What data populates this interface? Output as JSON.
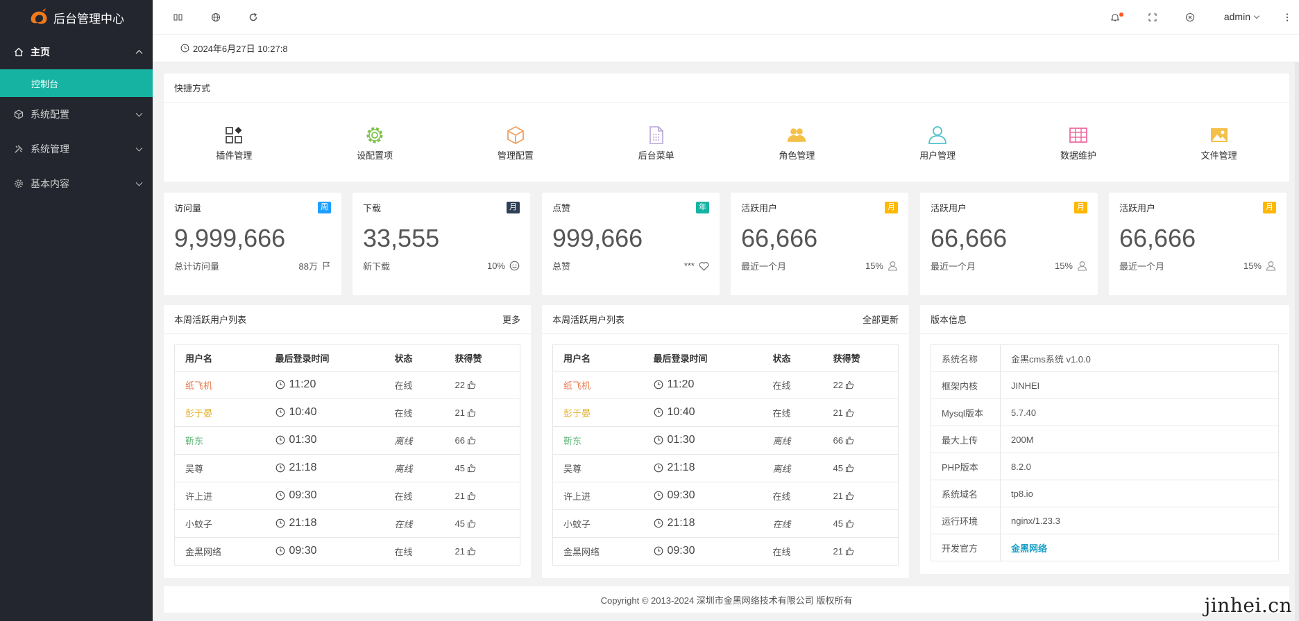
{
  "app": {
    "title": "后台管理中心"
  },
  "sidebar": {
    "items": [
      {
        "label": "主页",
        "icon": "home-icon"
      },
      {
        "label": "控制台"
      },
      {
        "label": "系统配置",
        "icon": "cube-icon"
      },
      {
        "label": "系统管理",
        "icon": "tools-icon"
      },
      {
        "label": "基本内容",
        "icon": "gear-icon"
      }
    ]
  },
  "header": {
    "user": "admin"
  },
  "timebar": {
    "datetime": "2024年6月27日 10:27:8"
  },
  "shortcuts": {
    "title": "快捷方式",
    "items": [
      {
        "label": "插件管理",
        "icon": "apps-icon",
        "color": "#333333"
      },
      {
        "label": "设配置项",
        "icon": "gear-icon",
        "color": "#7cc14a"
      },
      {
        "label": "管理配置",
        "icon": "box-icon",
        "color": "#f0a060"
      },
      {
        "label": "后台菜单",
        "icon": "document-icon",
        "color": "#b8a4d8"
      },
      {
        "label": "角色管理",
        "icon": "group-icon",
        "color": "#f5c04a"
      },
      {
        "label": "用户管理",
        "icon": "user-icon",
        "color": "#4ec2c9"
      },
      {
        "label": "数据维护",
        "icon": "table-icon",
        "color": "#f06ba0"
      },
      {
        "label": "文件管理",
        "icon": "image-icon",
        "color": "#f5c04a"
      }
    ]
  },
  "stats": [
    {
      "title": "访问量",
      "badge": "周",
      "badge_color": "#1e9fff",
      "value": "9,999,666",
      "foot_label": "总计访问量",
      "foot_value": "88万",
      "foot_icon": "flag-icon"
    },
    {
      "title": "下载",
      "badge": "月",
      "badge_color": "#2f4056",
      "value": "33,555",
      "foot_label": "新下载",
      "foot_value": "10%",
      "foot_icon": "smile-icon"
    },
    {
      "title": "点赞",
      "badge": "年",
      "badge_color": "#16b3a3",
      "value": "999,666",
      "foot_label": "总赞",
      "foot_value": "***",
      "foot_icon": "heart-icon"
    },
    {
      "title": "活跃用户",
      "badge": "月",
      "badge_color": "#ffb800",
      "value": "66,666",
      "foot_label": "最近一个月",
      "foot_value": "15%",
      "foot_icon": "user-icon"
    },
    {
      "title": "活跃用户",
      "badge": "月",
      "badge_color": "#ffb800",
      "value": "66,666",
      "foot_label": "最近一个月",
      "foot_value": "15%",
      "foot_icon": "user-icon"
    },
    {
      "title": "活跃用户",
      "badge": "月",
      "badge_color": "#ffb800",
      "value": "66,666",
      "foot_label": "最近一个月",
      "foot_value": "15%",
      "foot_icon": "user-icon"
    }
  ],
  "users_left": {
    "title": "本周活跃用户列表",
    "action": "更多",
    "columns": [
      "用户名",
      "最后登录时间",
      "状态",
      "获得赞"
    ],
    "rows": [
      {
        "name": "纸飞机",
        "color": "#e6784a",
        "time": "11:20",
        "status": "在线",
        "offline": false,
        "likes": "22"
      },
      {
        "name": "彭于晏",
        "color": "#e2b02a",
        "time": "10:40",
        "status": "在线",
        "offline": false,
        "likes": "21"
      },
      {
        "name": "靳东",
        "color": "#5fb878",
        "time": "01:30",
        "status": "离线",
        "offline": true,
        "likes": "66"
      },
      {
        "name": "吴尊",
        "color": "#555555",
        "time": "21:18",
        "status": "离线",
        "offline": true,
        "likes": "45"
      },
      {
        "name": "许上进",
        "color": "#555555",
        "time": "09:30",
        "status": "在线",
        "offline": false,
        "likes": "21"
      },
      {
        "name": "小蚊子",
        "color": "#555555",
        "time": "21:18",
        "status": "在线",
        "offline": true,
        "likes": "45"
      },
      {
        "name": "金黑网络",
        "color": "#555555",
        "time": "09:30",
        "status": "在线",
        "offline": false,
        "likes": "21"
      }
    ]
  },
  "users_right": {
    "title": "本周活跃用户列表",
    "action": "全部更新",
    "columns": [
      "用户名",
      "最后登录时间",
      "状态",
      "获得赞"
    ],
    "rows": [
      {
        "name": "纸飞机",
        "color": "#e6784a",
        "time": "11:20",
        "status": "在线",
        "offline": false,
        "likes": "22"
      },
      {
        "name": "彭于晏",
        "color": "#e2b02a",
        "time": "10:40",
        "status": "在线",
        "offline": false,
        "likes": "21"
      },
      {
        "name": "靳东",
        "color": "#5fb878",
        "time": "01:30",
        "status": "离线",
        "offline": true,
        "likes": "66"
      },
      {
        "name": "吴尊",
        "color": "#555555",
        "time": "21:18",
        "status": "离线",
        "offline": true,
        "likes": "45"
      },
      {
        "name": "许上进",
        "color": "#555555",
        "time": "09:30",
        "status": "在线",
        "offline": false,
        "likes": "21"
      },
      {
        "name": "小蚊子",
        "color": "#555555",
        "time": "21:18",
        "status": "在线",
        "offline": true,
        "likes": "45"
      },
      {
        "name": "金黑网络",
        "color": "#555555",
        "time": "09:30",
        "status": "在线",
        "offline": false,
        "likes": "21"
      }
    ]
  },
  "version": {
    "title": "版本信息",
    "rows": [
      {
        "key": "系统名称",
        "value": "金黑cms系统 v1.0.0"
      },
      {
        "key": "框架内核",
        "value": "JINHEI"
      },
      {
        "key": "Mysql版本",
        "value": "5.7.40"
      },
      {
        "key": "最大上传",
        "value": "200M"
      },
      {
        "key": "PHP版本",
        "value": "8.2.0"
      },
      {
        "key": "系统域名",
        "value": "tp8.io"
      },
      {
        "key": "运行环境",
        "value": "nginx/1.23.3"
      },
      {
        "key": "开发官方",
        "value": "金黑网络",
        "link": true
      }
    ]
  },
  "footer": {
    "copyright": "Copyright © 2013-2024 深圳市金黑网络技术有限公司 版权所有"
  },
  "watermark": "jinhei.cn"
}
